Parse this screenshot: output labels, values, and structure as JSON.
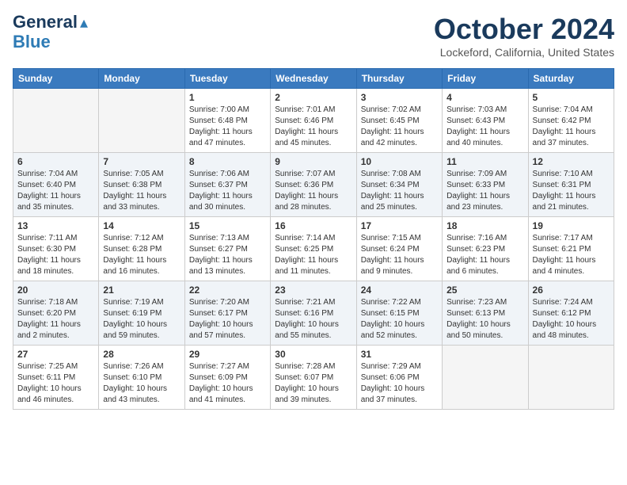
{
  "logo": {
    "line1": "General",
    "line2": "Blue"
  },
  "title": "October 2024",
  "location": "Lockeford, California, United States",
  "weekdays": [
    "Sunday",
    "Monday",
    "Tuesday",
    "Wednesday",
    "Thursday",
    "Friday",
    "Saturday"
  ],
  "weeks": [
    [
      {
        "day": "",
        "sunrise": "",
        "sunset": "",
        "daylight": ""
      },
      {
        "day": "",
        "sunrise": "",
        "sunset": "",
        "daylight": ""
      },
      {
        "day": "1",
        "sunrise": "Sunrise: 7:00 AM",
        "sunset": "Sunset: 6:48 PM",
        "daylight": "Daylight: 11 hours and 47 minutes."
      },
      {
        "day": "2",
        "sunrise": "Sunrise: 7:01 AM",
        "sunset": "Sunset: 6:46 PM",
        "daylight": "Daylight: 11 hours and 45 minutes."
      },
      {
        "day": "3",
        "sunrise": "Sunrise: 7:02 AM",
        "sunset": "Sunset: 6:45 PM",
        "daylight": "Daylight: 11 hours and 42 minutes."
      },
      {
        "day": "4",
        "sunrise": "Sunrise: 7:03 AM",
        "sunset": "Sunset: 6:43 PM",
        "daylight": "Daylight: 11 hours and 40 minutes."
      },
      {
        "day": "5",
        "sunrise": "Sunrise: 7:04 AM",
        "sunset": "Sunset: 6:42 PM",
        "daylight": "Daylight: 11 hours and 37 minutes."
      }
    ],
    [
      {
        "day": "6",
        "sunrise": "Sunrise: 7:04 AM",
        "sunset": "Sunset: 6:40 PM",
        "daylight": "Daylight: 11 hours and 35 minutes."
      },
      {
        "day": "7",
        "sunrise": "Sunrise: 7:05 AM",
        "sunset": "Sunset: 6:38 PM",
        "daylight": "Daylight: 11 hours and 33 minutes."
      },
      {
        "day": "8",
        "sunrise": "Sunrise: 7:06 AM",
        "sunset": "Sunset: 6:37 PM",
        "daylight": "Daylight: 11 hours and 30 minutes."
      },
      {
        "day": "9",
        "sunrise": "Sunrise: 7:07 AM",
        "sunset": "Sunset: 6:36 PM",
        "daylight": "Daylight: 11 hours and 28 minutes."
      },
      {
        "day": "10",
        "sunrise": "Sunrise: 7:08 AM",
        "sunset": "Sunset: 6:34 PM",
        "daylight": "Daylight: 11 hours and 25 minutes."
      },
      {
        "day": "11",
        "sunrise": "Sunrise: 7:09 AM",
        "sunset": "Sunset: 6:33 PM",
        "daylight": "Daylight: 11 hours and 23 minutes."
      },
      {
        "day": "12",
        "sunrise": "Sunrise: 7:10 AM",
        "sunset": "Sunset: 6:31 PM",
        "daylight": "Daylight: 11 hours and 21 minutes."
      }
    ],
    [
      {
        "day": "13",
        "sunrise": "Sunrise: 7:11 AM",
        "sunset": "Sunset: 6:30 PM",
        "daylight": "Daylight: 11 hours and 18 minutes."
      },
      {
        "day": "14",
        "sunrise": "Sunrise: 7:12 AM",
        "sunset": "Sunset: 6:28 PM",
        "daylight": "Daylight: 11 hours and 16 minutes."
      },
      {
        "day": "15",
        "sunrise": "Sunrise: 7:13 AM",
        "sunset": "Sunset: 6:27 PM",
        "daylight": "Daylight: 11 hours and 13 minutes."
      },
      {
        "day": "16",
        "sunrise": "Sunrise: 7:14 AM",
        "sunset": "Sunset: 6:25 PM",
        "daylight": "Daylight: 11 hours and 11 minutes."
      },
      {
        "day": "17",
        "sunrise": "Sunrise: 7:15 AM",
        "sunset": "Sunset: 6:24 PM",
        "daylight": "Daylight: 11 hours and 9 minutes."
      },
      {
        "day": "18",
        "sunrise": "Sunrise: 7:16 AM",
        "sunset": "Sunset: 6:23 PM",
        "daylight": "Daylight: 11 hours and 6 minutes."
      },
      {
        "day": "19",
        "sunrise": "Sunrise: 7:17 AM",
        "sunset": "Sunset: 6:21 PM",
        "daylight": "Daylight: 11 hours and 4 minutes."
      }
    ],
    [
      {
        "day": "20",
        "sunrise": "Sunrise: 7:18 AM",
        "sunset": "Sunset: 6:20 PM",
        "daylight": "Daylight: 11 hours and 2 minutes."
      },
      {
        "day": "21",
        "sunrise": "Sunrise: 7:19 AM",
        "sunset": "Sunset: 6:19 PM",
        "daylight": "Daylight: 10 hours and 59 minutes."
      },
      {
        "day": "22",
        "sunrise": "Sunrise: 7:20 AM",
        "sunset": "Sunset: 6:17 PM",
        "daylight": "Daylight: 10 hours and 57 minutes."
      },
      {
        "day": "23",
        "sunrise": "Sunrise: 7:21 AM",
        "sunset": "Sunset: 6:16 PM",
        "daylight": "Daylight: 10 hours and 55 minutes."
      },
      {
        "day": "24",
        "sunrise": "Sunrise: 7:22 AM",
        "sunset": "Sunset: 6:15 PM",
        "daylight": "Daylight: 10 hours and 52 minutes."
      },
      {
        "day": "25",
        "sunrise": "Sunrise: 7:23 AM",
        "sunset": "Sunset: 6:13 PM",
        "daylight": "Daylight: 10 hours and 50 minutes."
      },
      {
        "day": "26",
        "sunrise": "Sunrise: 7:24 AM",
        "sunset": "Sunset: 6:12 PM",
        "daylight": "Daylight: 10 hours and 48 minutes."
      }
    ],
    [
      {
        "day": "27",
        "sunrise": "Sunrise: 7:25 AM",
        "sunset": "Sunset: 6:11 PM",
        "daylight": "Daylight: 10 hours and 46 minutes."
      },
      {
        "day": "28",
        "sunrise": "Sunrise: 7:26 AM",
        "sunset": "Sunset: 6:10 PM",
        "daylight": "Daylight: 10 hours and 43 minutes."
      },
      {
        "day": "29",
        "sunrise": "Sunrise: 7:27 AM",
        "sunset": "Sunset: 6:09 PM",
        "daylight": "Daylight: 10 hours and 41 minutes."
      },
      {
        "day": "30",
        "sunrise": "Sunrise: 7:28 AM",
        "sunset": "Sunset: 6:07 PM",
        "daylight": "Daylight: 10 hours and 39 minutes."
      },
      {
        "day": "31",
        "sunrise": "Sunrise: 7:29 AM",
        "sunset": "Sunset: 6:06 PM",
        "daylight": "Daylight: 10 hours and 37 minutes."
      },
      {
        "day": "",
        "sunrise": "",
        "sunset": "",
        "daylight": ""
      },
      {
        "day": "",
        "sunrise": "",
        "sunset": "",
        "daylight": ""
      }
    ]
  ]
}
